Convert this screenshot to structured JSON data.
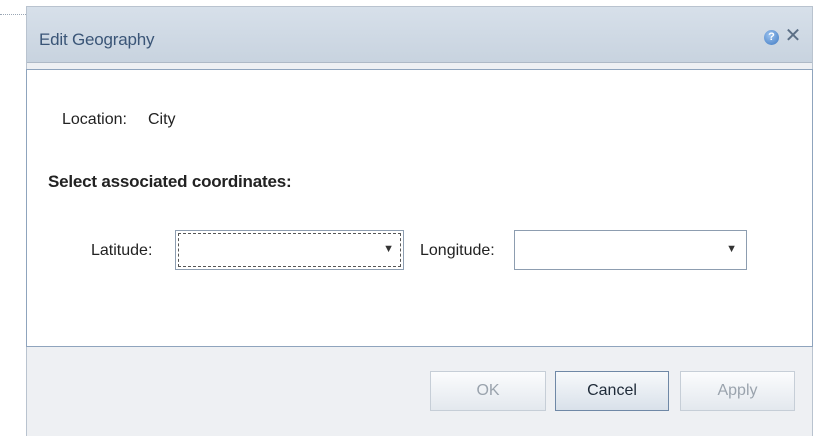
{
  "dialog": {
    "title": "Edit Geography",
    "help_icon": "question-circle-icon",
    "close_icon": "close-x-icon",
    "help_glyph": "?",
    "close_glyph": "✕"
  },
  "location": {
    "label": "Location:",
    "value": "City"
  },
  "coordinates": {
    "heading": "Select associated coordinates:",
    "latitude": {
      "label": "Latitude:",
      "selected": ""
    },
    "longitude": {
      "label": "Longitude:",
      "selected": ""
    },
    "arrow_glyph": "▼"
  },
  "buttons": {
    "ok": "OK",
    "cancel": "Cancel",
    "apply": "Apply"
  }
}
